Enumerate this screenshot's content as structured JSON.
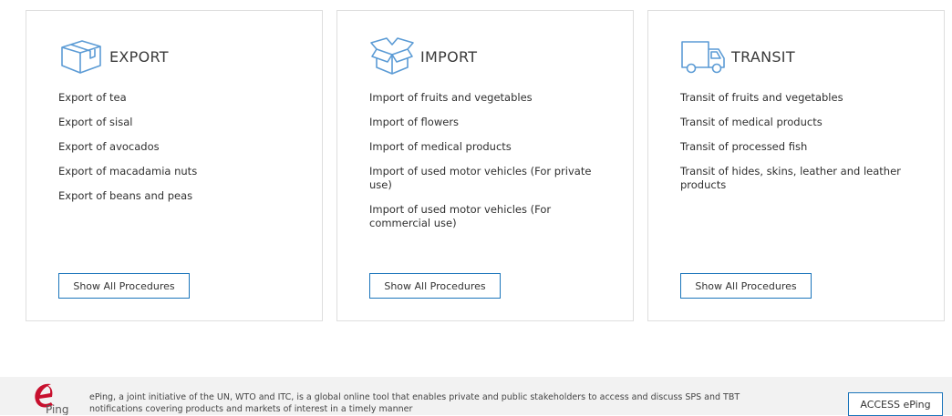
{
  "cards": [
    {
      "title": "EXPORT",
      "icon": "box-icon",
      "items": [
        "Export of tea",
        "Export of sisal",
        "Export of avocados",
        "Export of macadamia nuts",
        "Export of beans and peas"
      ],
      "button_label": "Show All Procedures"
    },
    {
      "title": "IMPORT",
      "icon": "open-box-icon",
      "items": [
        "Import of fruits and vegetables",
        "Import of flowers",
        "Import of medical products",
        "Import of used motor vehicles (For private use)",
        "Import of used motor vehicles (For commercial use)"
      ],
      "button_label": "Show All Procedures"
    },
    {
      "title": "TRANSIT",
      "icon": "truck-icon",
      "items": [
        "Transit of fruits and vegetables",
        "Transit of medical products",
        "Transit of processed fish",
        "Transit of hides, skins, leather and leather products"
      ],
      "button_label": "Show All Procedures"
    }
  ],
  "footer": {
    "logo_icon": "eping-logo-icon",
    "logo_text": "Ping",
    "text": "ePing, a joint initiative of the UN, WTO and ITC, is a global online tool that enables private and public stakeholders to access and discuss SPS and TBT notifications covering products and markets of interest in a timely manner",
    "button_label": "ACCESS ePing"
  },
  "colors": {
    "accent": "#1b75bb",
    "icon_stroke": "#5b9bd5",
    "logo_red": "#c8102e",
    "card_border": "#dedede"
  }
}
